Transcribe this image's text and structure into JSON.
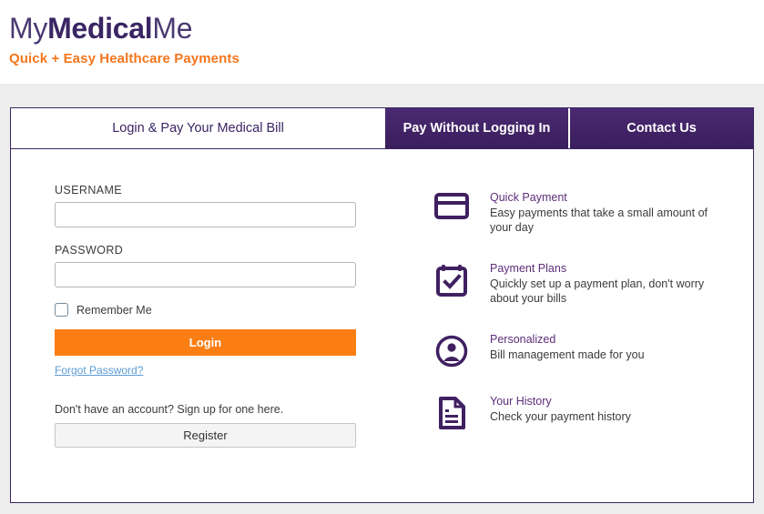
{
  "brand": {
    "logo_part1": "My",
    "logo_part2": "Medical",
    "logo_part3": "Me",
    "tagline": "Quick + Easy Healthcare Payments",
    "purple": "#3a2564",
    "orange": "#f4761d",
    "link_blue": "#5b9bd5"
  },
  "tabs": [
    {
      "label": "Login & Pay Your Medical Bill",
      "active": true
    },
    {
      "label": "Pay Without Logging In",
      "active": false
    },
    {
      "label": "Contact Us",
      "active": false
    }
  ],
  "login_form": {
    "username_label": "USERNAME",
    "username_value": "",
    "username_placeholder": "",
    "password_label": "PASSWORD",
    "password_value": "",
    "password_placeholder": "",
    "remember_label": "Remember Me",
    "remember_checked": false,
    "login_button": "Login",
    "forgot_link": "Forgot Password?",
    "signup_text": "Don't have an account? Sign up for one here.",
    "register_button": "Register"
  },
  "features": [
    {
      "icon": "credit-card-icon",
      "title": "Quick Payment",
      "desc": "Easy payments that take a small amount of your day"
    },
    {
      "icon": "calendar-check-icon",
      "title": "Payment Plans",
      "desc": "Quickly set up a payment plan, don't worry about your bills"
    },
    {
      "icon": "user-circle-icon",
      "title": "Personalized",
      "desc": "Bill management made for you"
    },
    {
      "icon": "document-icon",
      "title": "Your History",
      "desc": "Check your payment history"
    }
  ]
}
